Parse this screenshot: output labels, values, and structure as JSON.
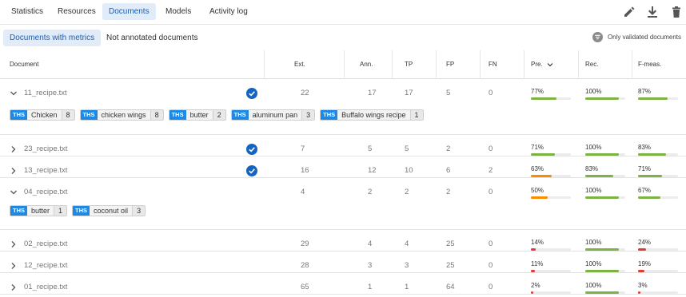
{
  "nav": {
    "tabs": [
      {
        "label": "Statistics"
      },
      {
        "label": "Resources"
      },
      {
        "label": "Documents",
        "active": true
      },
      {
        "label": "Models"
      },
      {
        "label": "Activity log"
      }
    ],
    "tools": [
      "edit-icon",
      "download-icon",
      "trash-icon"
    ]
  },
  "subnav": {
    "tabs": [
      {
        "label": "Documents with metrics",
        "active": true
      },
      {
        "label": "Not annotated documents"
      }
    ],
    "validated_label": "Only validated documents"
  },
  "table": {
    "headers": {
      "document": "Document",
      "ext": "Ext.",
      "ann": "Ann.",
      "tp": "TP",
      "fp": "FP",
      "fn": "FN",
      "pre": "Pre.",
      "rec": "Rec.",
      "fmeas": "F-meas."
    },
    "tag_prefix": "THS",
    "rows": [
      {
        "name": "11_recipe.txt",
        "expanded": true,
        "validated": true,
        "ext": "22",
        "ann": "17",
        "tp": "17",
        "fp": "5",
        "fn": "0",
        "pre": {
          "label": "77%",
          "value": 0.77,
          "color": "#7cb342"
        },
        "rec": {
          "label": "100%",
          "value": 1.0,
          "color": "#7cb342"
        },
        "fmeas": {
          "label": "87%",
          "value": 0.87,
          "color": "#7cb342"
        },
        "tags": [
          {
            "label": "Chicken",
            "count": "8"
          },
          {
            "label": "chicken wings",
            "count": "8"
          },
          {
            "label": "butter",
            "count": "2"
          },
          {
            "label": "aluminum pan",
            "count": "3"
          },
          {
            "label": "Buffalo wings recipe",
            "count": "1"
          }
        ]
      },
      {
        "name": "23_recipe.txt",
        "expanded": false,
        "validated": true,
        "ext": "7",
        "ann": "5",
        "tp": "5",
        "fp": "2",
        "fn": "0",
        "pre": {
          "label": "71%",
          "value": 0.71,
          "color": "#7cb342"
        },
        "rec": {
          "label": "100%",
          "value": 1.0,
          "color": "#7cb342"
        },
        "fmeas": {
          "label": "83%",
          "value": 0.83,
          "color": "#7cb342"
        },
        "tags": []
      },
      {
        "name": "13_recipe.txt",
        "expanded": false,
        "validated": true,
        "ext": "16",
        "ann": "12",
        "tp": "10",
        "fp": "6",
        "fn": "2",
        "pre": {
          "label": "63%",
          "value": 0.63,
          "color": "#fb8c00"
        },
        "rec": {
          "label": "83%",
          "value": 0.83,
          "color": "#7cb342"
        },
        "fmeas": {
          "label": "71%",
          "value": 0.71,
          "color": "#7cb342"
        },
        "tags": []
      },
      {
        "name": "04_recipe.txt",
        "expanded": true,
        "validated": false,
        "ext": "4",
        "ann": "2",
        "tp": "2",
        "fp": "2",
        "fn": "0",
        "pre": {
          "label": "50%",
          "value": 0.5,
          "color": "#fb8c00"
        },
        "rec": {
          "label": "100%",
          "value": 1.0,
          "color": "#7cb342"
        },
        "fmeas": {
          "label": "67%",
          "value": 0.67,
          "color": "#7cb342"
        },
        "tags": [
          {
            "label": "butter",
            "count": "1"
          },
          {
            "label": "coconut oil",
            "count": "3"
          }
        ]
      },
      {
        "name": "02_recipe.txt",
        "expanded": false,
        "validated": false,
        "ext": "29",
        "ann": "4",
        "tp": "4",
        "fp": "25",
        "fn": "0",
        "pre": {
          "label": "14%",
          "value": 0.14,
          "color": "#e53935"
        },
        "rec": {
          "label": "100%",
          "value": 1.0,
          "color": "#7cb342"
        },
        "fmeas": {
          "label": "24%",
          "value": 0.24,
          "color": "#e53935"
        },
        "tags": []
      },
      {
        "name": "12_recipe.txt",
        "expanded": false,
        "validated": false,
        "ext": "28",
        "ann": "3",
        "tp": "3",
        "fp": "25",
        "fn": "0",
        "pre": {
          "label": "11%",
          "value": 0.11,
          "color": "#e53935"
        },
        "rec": {
          "label": "100%",
          "value": 1.0,
          "color": "#7cb342"
        },
        "fmeas": {
          "label": "19%",
          "value": 0.19,
          "color": "#e53935"
        },
        "tags": []
      },
      {
        "name": "01_recipe.txt",
        "expanded": false,
        "validated": false,
        "ext": "65",
        "ann": "1",
        "tp": "1",
        "fp": "64",
        "fn": "0",
        "pre": {
          "label": "2%",
          "value": 0.02,
          "color": "#e53935"
        },
        "rec": {
          "label": "100%",
          "value": 1.0,
          "color": "#7cb342"
        },
        "fmeas": {
          "label": "3%",
          "value": 0.03,
          "color": "#e53935"
        },
        "tags": []
      }
    ]
  }
}
